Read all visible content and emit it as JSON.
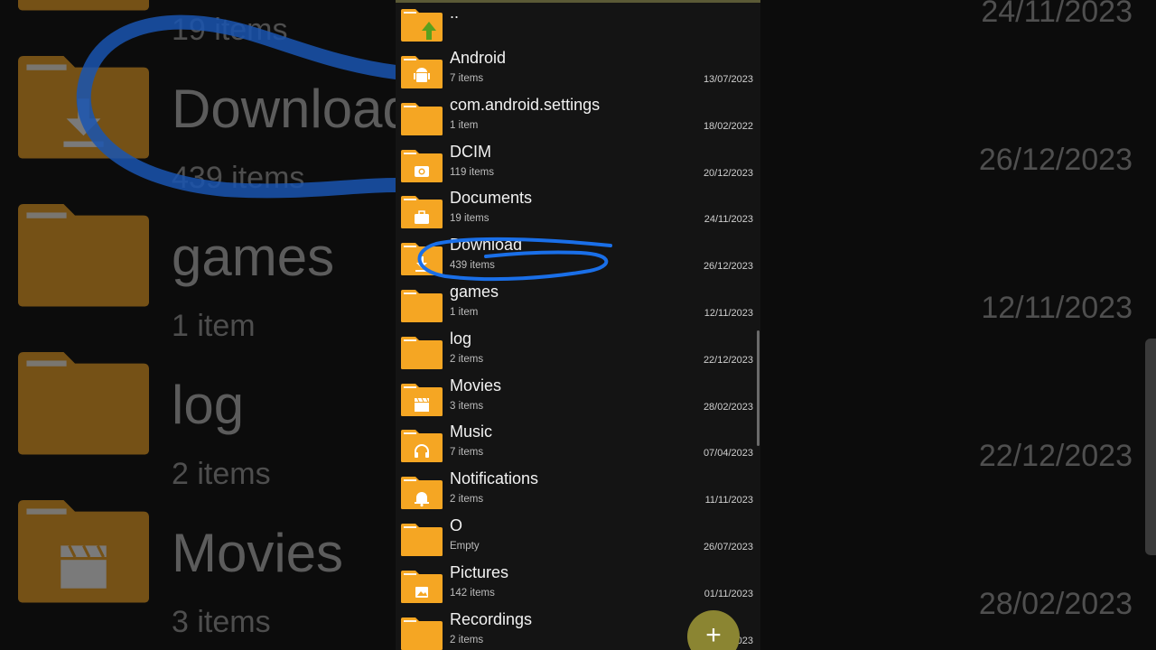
{
  "parent_entry": {
    "label": "..",
    "icon": "folder-up-icon"
  },
  "folders": [
    {
      "name": "Android",
      "count": "7 items",
      "date": "13/07/2023",
      "icon": "android-icon"
    },
    {
      "name": "com.android.settings",
      "count": "1 item",
      "date": "18/02/2022",
      "icon": ""
    },
    {
      "name": "DCIM",
      "count": "119 items",
      "date": "20/12/2023",
      "icon": "camera-icon"
    },
    {
      "name": "Documents",
      "count": "19 items",
      "date": "24/11/2023",
      "icon": "briefcase-icon"
    },
    {
      "name": "Download",
      "count": "439 items",
      "date": "26/12/2023",
      "icon": "download-icon"
    },
    {
      "name": "games",
      "count": "1 item",
      "date": "12/11/2023",
      "icon": ""
    },
    {
      "name": "log",
      "count": "2 items",
      "date": "22/12/2023",
      "icon": ""
    },
    {
      "name": "Movies",
      "count": "3 items",
      "date": "28/02/2023",
      "icon": "clapperboard-icon"
    },
    {
      "name": "Music",
      "count": "7 items",
      "date": "07/04/2023",
      "icon": "headphones-icon"
    },
    {
      "name": "Notifications",
      "count": "2 items",
      "date": "11/11/2023",
      "icon": "bell-icon"
    },
    {
      "name": "O",
      "count": "Empty",
      "date": "26/07/2023",
      "icon": ""
    },
    {
      "name": "Pictures",
      "count": "142 items",
      "date": "01/11/2023",
      "icon": "image-icon"
    },
    {
      "name": "Recordings",
      "count": "2 items",
      "date": "023",
      "icon": ""
    }
  ],
  "fab": {
    "label": "+"
  },
  "background": {
    "left_rows": [
      {
        "name": "",
        "count": "19 items",
        "icon": ""
      },
      {
        "name": "Download",
        "count": "439 items",
        "icon": "download-icon"
      },
      {
        "name": "games",
        "count": "1 item",
        "icon": ""
      },
      {
        "name": "log",
        "count": "2 items",
        "icon": ""
      },
      {
        "name": "Movies",
        "count": "3 items",
        "icon": "clapperboard-icon"
      }
    ],
    "right_dates": [
      "24/11/2023",
      "26/12/2023",
      "12/11/2023",
      "22/12/2023",
      "28/02/2023"
    ]
  },
  "colors": {
    "folder": "#f5a623",
    "folder_dark": "#e08e12",
    "annotation": "#1a6fe8",
    "up_arrow": "#5aa01e",
    "fab": "#8b8532"
  }
}
